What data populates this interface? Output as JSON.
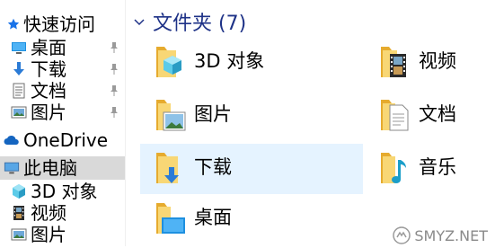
{
  "sidebar": {
    "quick_access": {
      "label": "快速访问",
      "icon": "star-icon",
      "color": "#1a73e8"
    },
    "pinned": [
      {
        "label": "桌面",
        "icon": "desktop-icon"
      },
      {
        "label": "下载",
        "icon": "download-arrow-icon"
      },
      {
        "label": "文档",
        "icon": "document-icon"
      },
      {
        "label": "图片",
        "icon": "pictures-icon"
      }
    ],
    "onedrive": {
      "label": "OneDrive",
      "icon": "cloud-icon"
    },
    "this_pc": {
      "label": "此电脑",
      "icon": "computer-icon",
      "selected": true
    },
    "pc_items": [
      {
        "label": "3D 对象",
        "icon": "cube-3d-icon"
      },
      {
        "label": "视频",
        "icon": "film-icon"
      },
      {
        "label": "图片",
        "icon": "pictures-icon"
      }
    ]
  },
  "main": {
    "folders_header": "文件夹 (7)",
    "folders": [
      {
        "label": "3D 对象",
        "icon": "folder-3d-objects-icon"
      },
      {
        "label": "视频",
        "icon": "folder-videos-icon"
      },
      {
        "label": "图片",
        "icon": "folder-pictures-icon"
      },
      {
        "label": "文档",
        "icon": "folder-documents-icon"
      },
      {
        "label": "下载",
        "icon": "folder-downloads-icon",
        "hovered": true
      },
      {
        "label": "音乐",
        "icon": "folder-music-icon"
      },
      {
        "label": "桌面",
        "icon": "folder-desktop-icon"
      }
    ]
  },
  "watermark": {
    "text": "SMYZ.NET"
  },
  "colors": {
    "accent": "#1e3287",
    "folder": "#f5c451",
    "hover": "#e5f3ff",
    "selected": "#d9d9d9"
  }
}
